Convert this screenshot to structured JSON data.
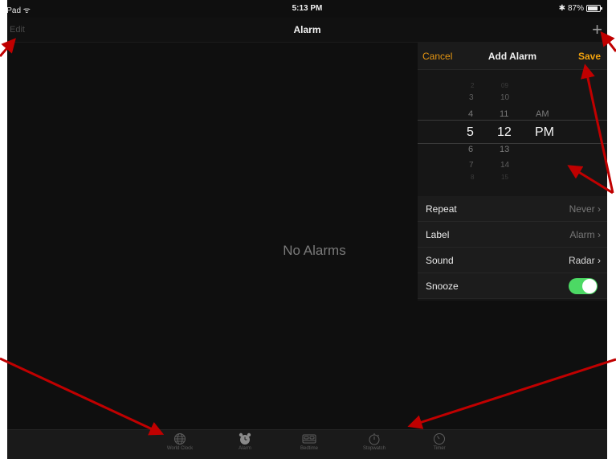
{
  "status": {
    "device": "iPad",
    "time": "5:13 PM",
    "battery": "87%"
  },
  "nav": {
    "edit": "Edit",
    "title": "Alarm",
    "add": "+"
  },
  "empty_text": "No Alarms",
  "popover": {
    "cancel": "Cancel",
    "title": "Add Alarm",
    "save": "Save",
    "picker": {
      "hours": [
        "2",
        "3",
        "4",
        "5",
        "6",
        "7",
        "8"
      ],
      "minutes": [
        "09",
        "10",
        "11",
        "12",
        "13",
        "14",
        "15"
      ],
      "ampm": [
        "AM",
        "PM"
      ]
    },
    "rows": [
      {
        "label": "Repeat",
        "value": "Never"
      },
      {
        "label": "Label",
        "value": "Alarm"
      },
      {
        "label": "Sound",
        "value": "Radar"
      },
      {
        "label": "Snooze"
      }
    ]
  },
  "tabs": [
    "World Clock",
    "Alarm",
    "Bedtime",
    "Stopwatch",
    "Timer"
  ],
  "colors": {
    "accent": "#f2a20e",
    "toggle_on": "#4cd964",
    "annotation_arrow": "#c00000"
  }
}
